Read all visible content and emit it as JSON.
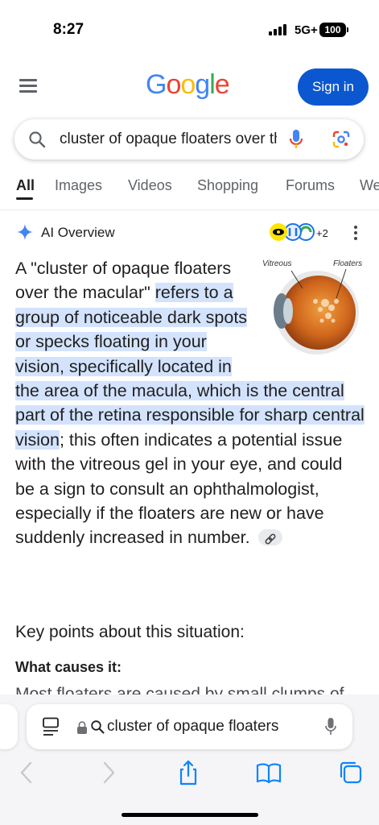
{
  "status_bar": {
    "time": "8:27",
    "network": "5G+",
    "battery": "100"
  },
  "header": {
    "logo_letters": [
      "G",
      "o",
      "o",
      "g",
      "l",
      "e"
    ],
    "logo_colors": [
      "#4285F4",
      "#EA4335",
      "#FBBC05",
      "#4285F4",
      "#34A853",
      "#EA4335"
    ],
    "sign_in_label": "Sign in",
    "menu_icon": "hamburger-menu-icon"
  },
  "search": {
    "query": "cluster of opaque floaters over the macular",
    "icons": [
      "search-icon",
      "mic-icon",
      "google-lens-icon"
    ]
  },
  "tabs": [
    "All",
    "Images",
    "Videos",
    "Shopping",
    "Forums",
    "Web"
  ],
  "active_tab": "All",
  "ai_overview": {
    "title": "AI Overview",
    "sources_more": "+2",
    "figure_labels": {
      "vitreous": "Vitreous",
      "floaters": "Floaters"
    },
    "text_plain_1": "A \"cluster of opaque floaters over the macular\"",
    "text_highlight": "refers to a group of noticeable dark spots or specks floating in your vision, specifically located in the area of the macula, which is the central part of the retina responsible for sharp central vision",
    "text_plain_2": "; this often indicates a potential issue with the vitreous gel in your eye, and could be a sign to consult an ophthalmologist, especially if the floaters are new or have suddenly increased in number.",
    "key_points_heading": "Key points about this situation:",
    "subheading": "What causes it:",
    "cut_off_line": "Most floaters are caused by small clumps of"
  },
  "browser": {
    "address_text": "cluster of opaque floaters",
    "icons": [
      "reader-mode-icon",
      "lock-icon",
      "search-icon",
      "mic-icon",
      "back-arrow-icon",
      "forward-arrow-icon",
      "share-icon",
      "bookmarks-icon",
      "tabs-icon"
    ]
  },
  "colors": {
    "accent_blue": "#0b57d0",
    "highlight": "#d3e3fd",
    "icon_gray": "#5f6368"
  }
}
